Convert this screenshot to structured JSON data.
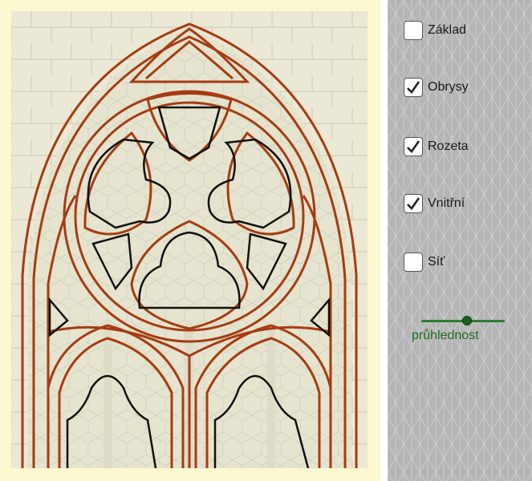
{
  "checkboxes": [
    {
      "label": "Základ",
      "checked": false
    },
    {
      "label": "Obrysy",
      "checked": true
    },
    {
      "label": "Rozeta",
      "checked": true
    },
    {
      "label": "Vnitřní",
      "checked": true
    },
    {
      "label": "Síť",
      "checked": false
    }
  ],
  "slider": {
    "label": "průhlednost",
    "value": 0.55
  },
  "colors": {
    "panel_background": "#fcf8cf",
    "tracery_outline": "#a63c12",
    "inner_outline": "#111111",
    "slider": "#2e7d32",
    "grid_background": "#b5b5b5"
  },
  "icons": {
    "check": "check-mark-icon"
  }
}
